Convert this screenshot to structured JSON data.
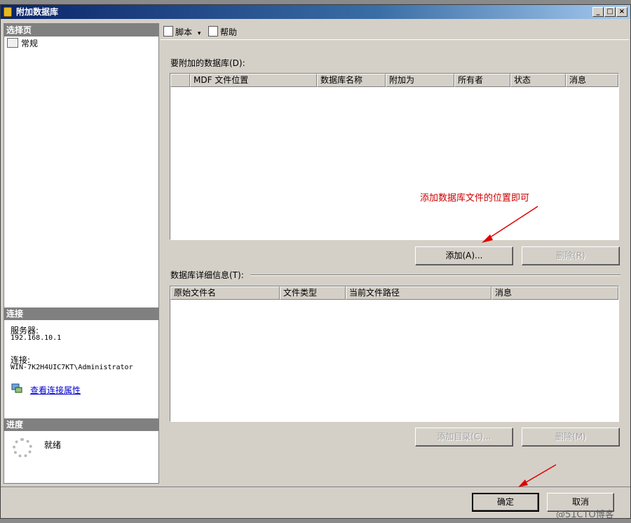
{
  "window": {
    "title": "附加数据库",
    "min": "_",
    "max": "□",
    "close": "×"
  },
  "left": {
    "select_page_header": "选择页",
    "nav_items": [
      {
        "label": "常规"
      }
    ],
    "connection_header": "连接",
    "server_label": "服务器:",
    "server_value": "192.168.10.1",
    "connection_label": "连接:",
    "connection_value": "WIN-7K2H4UIC7KT\\Administrator",
    "view_props_link": "查看连接属性",
    "progress_header": "进度",
    "progress_status": "就绪"
  },
  "toolbar": {
    "script_label": "脚本",
    "help_label": "帮助",
    "dropdown": "▾"
  },
  "attach": {
    "section_label": "要附加的数据库(D):",
    "columns": [
      "MDF 文件位置",
      "数据库名称",
      "附加为",
      "所有者",
      "状态",
      "消息"
    ],
    "rows": [],
    "add_button": "添加(A)...",
    "remove_button": "删除(R)"
  },
  "details": {
    "section_label": "数据库详细信息(T):",
    "columns": [
      "原始文件名",
      "文件类型",
      "当前文件路径",
      "消息"
    ],
    "rows": [],
    "add_catalog_button": "添加目录(C)...",
    "remove_button": "删除(M)"
  },
  "annotation": {
    "text": "添加数据库文件的位置即可",
    "color": "#cc0000"
  },
  "footer": {
    "ok_button": "确定",
    "cancel_button": "取消"
  },
  "watermark": "@51CTO博客"
}
